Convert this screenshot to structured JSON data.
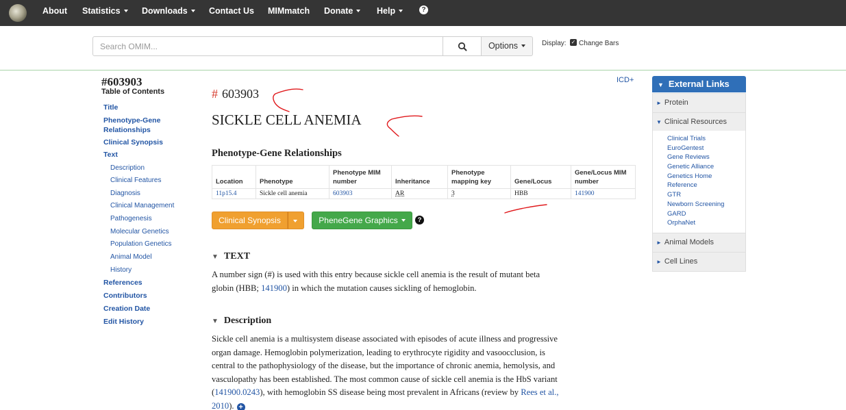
{
  "navbar": {
    "items": [
      {
        "label": "About",
        "dropdown": false
      },
      {
        "label": "Statistics",
        "dropdown": true
      },
      {
        "label": "Downloads",
        "dropdown": true
      },
      {
        "label": "Contact Us",
        "dropdown": false
      },
      {
        "label": "MIMmatch",
        "dropdown": false
      },
      {
        "label": "Donate",
        "dropdown": true
      },
      {
        "label": "Help",
        "dropdown": true
      }
    ],
    "help_icon": "?"
  },
  "search": {
    "placeholder": "Search OMIM...",
    "options_label": "Options",
    "display_label": "Display:",
    "change_bars_label": "Change Bars",
    "change_bars_checked": true
  },
  "toc": {
    "entry_number": "#603903",
    "title": "Table of Contents",
    "links": [
      {
        "label": "Title",
        "level": 0
      },
      {
        "label": "Phenotype-Gene Relationships",
        "level": 0
      },
      {
        "label": "Clinical Synopsis",
        "level": 0
      },
      {
        "label": "Text",
        "level": 0
      },
      {
        "label": "Description",
        "level": 1
      },
      {
        "label": "Clinical Features",
        "level": 1
      },
      {
        "label": "Diagnosis",
        "level": 1
      },
      {
        "label": "Clinical Management",
        "level": 1
      },
      {
        "label": "Pathogenesis",
        "level": 1
      },
      {
        "label": "Molecular Genetics",
        "level": 1
      },
      {
        "label": "Population Genetics",
        "level": 1
      },
      {
        "label": "Animal Model",
        "level": 1
      },
      {
        "label": "History",
        "level": 1
      },
      {
        "label": "References",
        "level": 0
      },
      {
        "label": "Contributors",
        "level": 0
      },
      {
        "label": "Creation Date",
        "level": 0
      },
      {
        "label": "Edit History",
        "level": 0
      }
    ]
  },
  "entry": {
    "icd_link": "ICD+",
    "hash": "#",
    "number": "603903",
    "title": "SICKLE CELL ANEMIA"
  },
  "pgr": {
    "heading": "Phenotype-Gene Relationships",
    "columns": [
      "Location",
      "Phenotype",
      "Phenotype MIM number",
      "Inheritance",
      "Phenotype mapping key",
      "Gene/Locus",
      "Gene/Locus MIM number"
    ],
    "rows": [
      [
        "11p15.4",
        "Sickle cell anemia",
        "603903",
        "AR",
        "3",
        "HBB",
        "141900"
      ]
    ]
  },
  "buttons": {
    "clinical_synopsis": "Clinical Synopsis",
    "phenegene": "PheneGene Graphics",
    "help_icon": "?"
  },
  "text_section": {
    "heading": "TEXT",
    "lines": [
      "A number sign (#) is used with this entry because sickle cell anemia is the result of mutant beta",
      [
        "globin (HBB; ",
        "141900",
        ") in which the mutation causes sickling of hemoglobin."
      ]
    ]
  },
  "description_section": {
    "heading": "Description",
    "lines": [
      "Sickle cell anemia is a multisystem disease associated with episodes of acute illness and progressive",
      "organ damage. Hemoglobin polymerization, leading to erythrocyte rigidity and vasoocclusion, is",
      "central to the pathophysiology of the disease, but the importance of chronic anemia, hemolysis, and",
      "vasculopathy has been established. The most common cause of sickle cell anemia is the HbS variant",
      [
        "(",
        "141900.0243",
        "), with hemoglobin SS disease being most prevalent in Africans (review by ",
        "Rees et al.,",
        ""
      ],
      [
        "",
        "2010",
        ")."
      ]
    ]
  },
  "external_links": {
    "header": "External Links",
    "panels": {
      "protein": "Protein",
      "clinical_resources": "Clinical Resources",
      "animal_models": "Animal Models",
      "cell_lines": "Cell Lines"
    },
    "clinical_resources_items": [
      "Clinical Trials",
      "EuroGentest",
      "Gene Reviews",
      "Genetic Alliance",
      "Genetics Home",
      "Reference",
      "GTR",
      "Newborn Screening",
      "GARD",
      "OrphaNet"
    ]
  },
  "colors": {
    "navbar_bg": "#353535",
    "link_blue": "#2255a4",
    "panel_header_blue": "#2f6fb8",
    "orange_button": "#f0a030",
    "green_button": "#44a84a",
    "annotation_red": "#e0191c"
  }
}
